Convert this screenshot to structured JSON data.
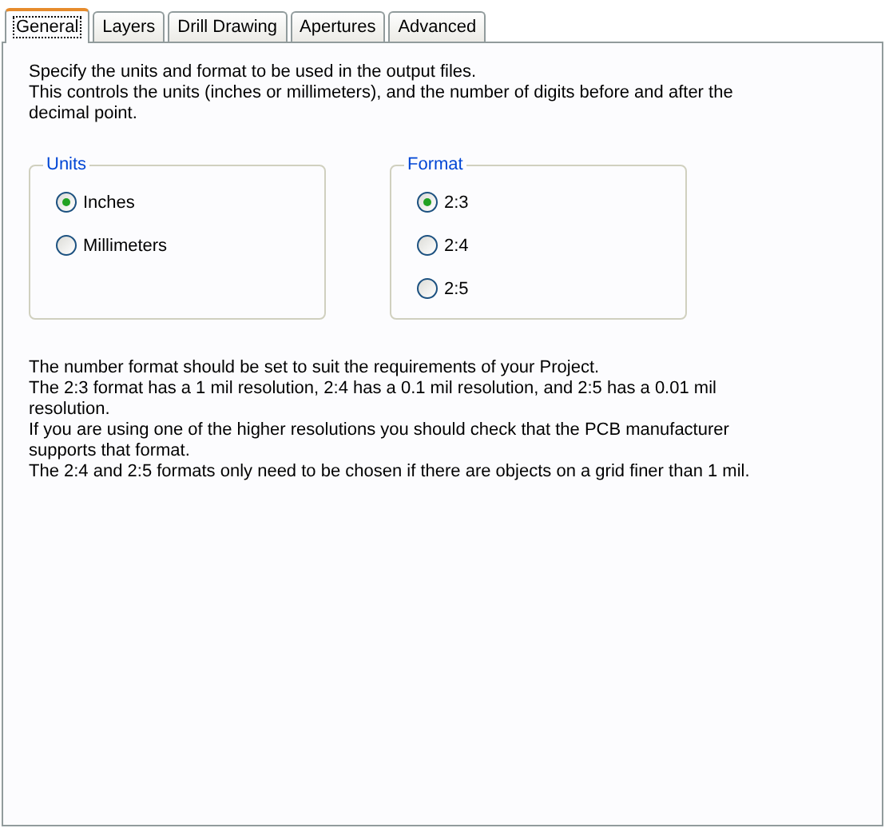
{
  "tabs": [
    {
      "label": "General",
      "selected": true
    },
    {
      "label": "Layers",
      "selected": false
    },
    {
      "label": "Drill Drawing",
      "selected": false
    },
    {
      "label": "Apertures",
      "selected": false
    },
    {
      "label": "Advanced",
      "selected": false
    }
  ],
  "intro": [
    "Specify the units and format to be used in the output files.",
    "This controls the units (inches or millimeters), and the number of digits before and after the decimal point."
  ],
  "groups": [
    {
      "title": "Units",
      "options": [
        {
          "label": "Inches",
          "selected": true
        },
        {
          "label": "Millimeters",
          "selected": false
        }
      ]
    },
    {
      "title": "Format",
      "options": [
        {
          "label": "2:3",
          "selected": true
        },
        {
          "label": "2:4",
          "selected": false
        },
        {
          "label": "2:5",
          "selected": false
        }
      ]
    }
  ],
  "notes": [
    "The number format should be set to suit the requirements of your Project.",
    "The 2:3 format has a 1 mil resolution, 2:4 has a 0.1 mil resolution, and 2:5 has a 0.01 mil resolution.",
    "If you are using one of the higher resolutions you should check that the PCB manufacturer supports that format.",
    "The 2:4 and 2:5 formats only need to be chosen if there are objects on a grid finer than 1 mil."
  ]
}
